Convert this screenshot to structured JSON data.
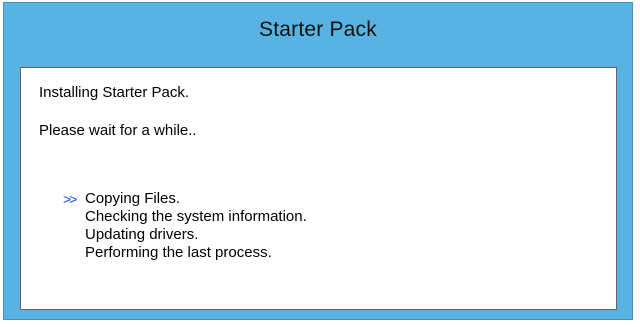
{
  "window": {
    "title": "Starter Pack"
  },
  "messages": {
    "installing": "Installing Starter Pack.",
    "wait": "Please wait for a while.."
  },
  "steps": [
    {
      "label": "Copying Files.",
      "current": true,
      "marker": ">>"
    },
    {
      "label": "Checking the system information.",
      "current": false,
      "marker": ""
    },
    {
      "label": "Updating drivers.",
      "current": false,
      "marker": ""
    },
    {
      "label": "Performing the last process.",
      "current": false,
      "marker": ""
    }
  ],
  "colors": {
    "frame": "#58b3e2",
    "marker": "#1e4fc8"
  }
}
